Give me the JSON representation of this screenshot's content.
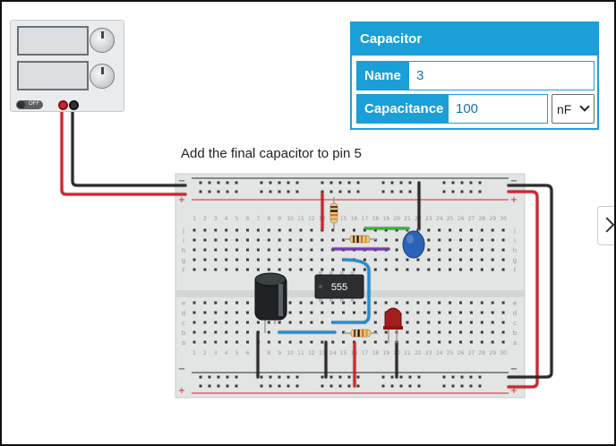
{
  "instruction": "Add the final capacitor to pin 5",
  "capacitor_panel": {
    "title": "Capacitor",
    "name_label": "Name",
    "name_value": "3",
    "capacitance_label": "Capacitance",
    "capacitance_value": "100",
    "unit_value": "nF"
  },
  "power_supply": {
    "switch_label": "OFF"
  },
  "breadboard": {
    "ic_label": "555",
    "column_numbers": [
      "1",
      "2",
      "3",
      "4",
      "5",
      "6",
      "7",
      "8",
      "9",
      "10",
      "11",
      "12",
      "13",
      "14",
      "15",
      "16",
      "17",
      "18",
      "19",
      "20",
      "21",
      "22",
      "23",
      "24",
      "25",
      "26",
      "27",
      "28",
      "29",
      "30"
    ],
    "row_letters_top": [
      "j",
      "i",
      "h",
      "g",
      "f"
    ],
    "row_letters_bottom": [
      "e",
      "d",
      "c",
      "b",
      "a"
    ],
    "rail_minus": "−",
    "rail_plus": "+"
  },
  "colors": {
    "accent": "#1a9fd8",
    "wire_red": "#d6222a",
    "wire_black": "#2a2a2a",
    "wire_blue": "#1c8fd4",
    "wire_green": "#3cae3c",
    "wire_purple": "#7a3aa8",
    "capacitor_blue": "#2a63b8",
    "led_red": "#a41d1d"
  },
  "icons": {
    "side_arrow": "chevron-right-icon",
    "unit_dropdown": "chevron-down-icon"
  }
}
